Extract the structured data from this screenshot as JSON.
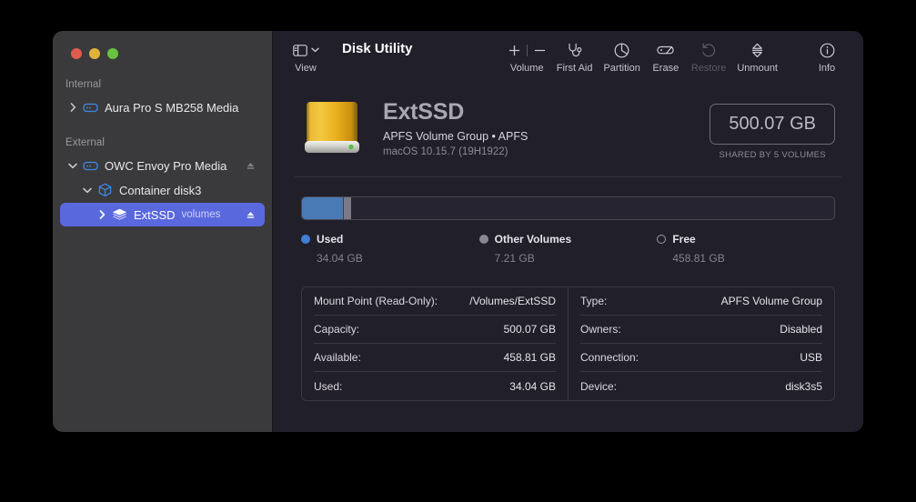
{
  "window": {
    "title": "Disk Utility",
    "traffic_lights": [
      "close-button",
      "minimize-button",
      "zoom-button"
    ]
  },
  "sidebar": {
    "sections": [
      {
        "label": "Internal",
        "items": [
          {
            "label": "Aura Pro S MB258 Media",
            "icon": "hard-drive-icon",
            "twisty": "collapsed",
            "indent": 1,
            "selected": false,
            "eject": false,
            "sub": ""
          }
        ]
      },
      {
        "label": "External",
        "items": [
          {
            "label": "OWC Envoy Pro Media",
            "icon": "hard-drive-icon",
            "twisty": "expanded",
            "indent": 1,
            "selected": false,
            "eject": true,
            "sub": ""
          },
          {
            "label": "Container disk3",
            "icon": "container-box-icon",
            "twisty": "expanded",
            "indent": 2,
            "selected": false,
            "eject": false,
            "sub": ""
          },
          {
            "label": "ExtSSD",
            "icon": "volume-stack-icon",
            "twisty": "collapsed",
            "indent": 3,
            "selected": true,
            "eject": true,
            "sub": "volumes"
          }
        ]
      }
    ]
  },
  "toolbar": {
    "view_label": "View",
    "items": [
      {
        "label": "Volume",
        "icon": "plus-minus-icon",
        "disabled": false
      },
      {
        "label": "First Aid",
        "icon": "stethoscope-icon",
        "disabled": false
      },
      {
        "label": "Partition",
        "icon": "pie-chart-icon",
        "disabled": false
      },
      {
        "label": "Erase",
        "icon": "erase-drive-icon",
        "disabled": false
      },
      {
        "label": "Restore",
        "icon": "undo-arrow-icon",
        "disabled": true
      },
      {
        "label": "Unmount",
        "icon": "eject-icon",
        "disabled": false
      },
      {
        "label": "Info",
        "icon": "info-circle-icon",
        "disabled": false
      }
    ]
  },
  "volume": {
    "name": "ExtSSD",
    "type_line": "APFS Volume Group • APFS",
    "os_line": "macOS 10.15.7 (19H1922)",
    "capacity": "500.07 GB",
    "shared_note": "SHARED BY 5 VOLUMES"
  },
  "usage": {
    "segments": [
      {
        "key": "used",
        "percent": 7.8
      },
      {
        "key": "other",
        "percent": 1.5
      }
    ],
    "legend": [
      {
        "name": "Used",
        "value": "34.04 GB",
        "marker": "filled-blue"
      },
      {
        "name": "Other Volumes",
        "value": "7.21 GB",
        "marker": "filled-gray"
      },
      {
        "name": "Free",
        "value": "458.81 GB",
        "marker": "outline"
      }
    ]
  },
  "info_table": {
    "left": [
      {
        "key": "Mount Point (Read-Only):",
        "value": "/Volumes/ExtSSD"
      },
      {
        "key": "Capacity:",
        "value": "500.07 GB"
      },
      {
        "key": "Available:",
        "value": "458.81 GB"
      },
      {
        "key": "Used:",
        "value": "34.04 GB"
      }
    ],
    "right": [
      {
        "key": "Type:",
        "value": "APFS Volume Group"
      },
      {
        "key": "Owners:",
        "value": "Disabled"
      },
      {
        "key": "Connection:",
        "value": "USB"
      },
      {
        "key": "Device:",
        "value": "disk3s5"
      }
    ]
  },
  "colors": {
    "accent": "#5a68de",
    "used": "#4a7ab5",
    "other": "#7c7986",
    "sidebar_bg": "#3a3a3c",
    "main_bg": "#211f29"
  }
}
